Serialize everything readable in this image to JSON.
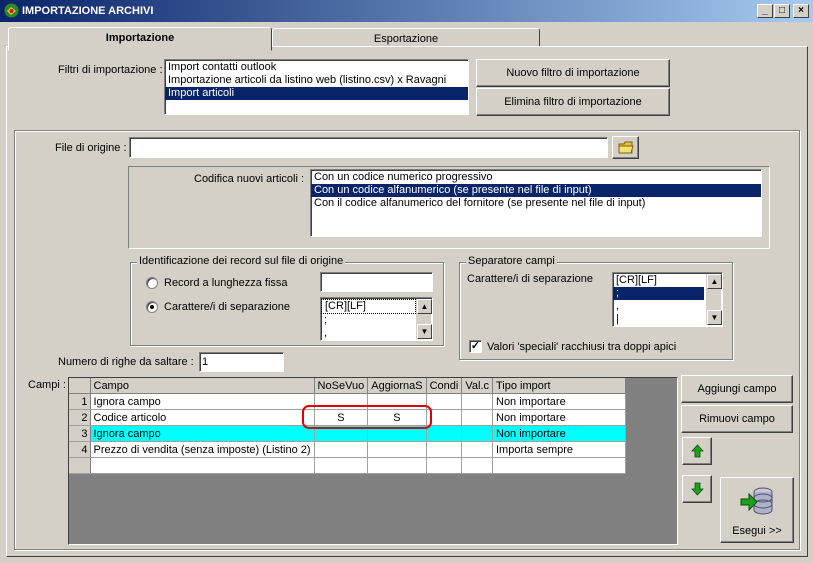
{
  "window": {
    "title": "IMPORTAZIONE ARCHIVI",
    "min_label": "_",
    "max_label": "□",
    "close_label": "×"
  },
  "tabs": [
    {
      "label": "Importazione"
    },
    {
      "label": "Esportazione"
    }
  ],
  "filters": {
    "label": "Filtri di importazione :",
    "items": [
      "Import contatti outlook",
      "Importazione articoli da listino web (listino.csv) x Ravagni",
      "Import articoli"
    ],
    "selected_index": 2,
    "new_button": "Nuovo filtro di importazione",
    "delete_button": "Elimina filtro di importazione"
  },
  "source_file": {
    "label": "File di origine :",
    "value": ""
  },
  "encoding": {
    "label": "Codifica nuovi articoli :",
    "options": [
      "Con un codice numerico progressivo",
      "Con un codice alfanumerico (se presente nel file di input)",
      "Con il codice alfanumerico del fornitore (se presente nel file di input)"
    ],
    "selected_index": 1
  },
  "record_identification": {
    "legend": "Identificazione dei record sul file di origine",
    "fixed_length_label": "Record a lunghezza fissa",
    "fixed_length_value": "",
    "separator_label": "Carattere/i di separazione",
    "separator_items": [
      "[CR][LF]",
      ";",
      ","
    ]
  },
  "field_separator": {
    "legend": "Separatore campi",
    "label": "Carattere/i di separazione",
    "items": [
      "[CR][LF]",
      ";",
      ",",
      "|"
    ],
    "selected_index": 1,
    "special_values_label": "Valori 'speciali' racchiusi tra doppi apici",
    "special_values_checked": "✓"
  },
  "skip_rows": {
    "label": "Numero di righe da saltare  :",
    "value": "1"
  },
  "fields": {
    "label": "Campi :",
    "columns": [
      "Campo",
      "NoSeVuo",
      "AggiornaS",
      "Condi",
      "Val.c",
      "Tipo import"
    ],
    "rows": [
      {
        "num": "1",
        "campo": "Ignora campo",
        "nosevuo": "",
        "aggiorna": "",
        "condi": "",
        "valc": "",
        "tipo": "Non importare"
      },
      {
        "num": "2",
        "campo": "Codice articolo",
        "nosevuo": "S",
        "aggiorna": "S",
        "condi": "",
        "valc": "",
        "tipo": "Non importare"
      },
      {
        "num": "3",
        "campo": "Ignora campo",
        "nosevuo": "",
        "aggiorna": "",
        "condi": "",
        "valc": "",
        "tipo": "Non importare"
      },
      {
        "num": "4",
        "campo": "Prezzo di vendita (senza imposte) (Listino 2)",
        "nosevuo": "",
        "aggiorna": "",
        "condi": "",
        "valc": "",
        "tipo": "Importa sempre"
      }
    ],
    "selected_row": 2,
    "add_button": "Aggiungi campo",
    "remove_button": "Rimuovi campo",
    "execute_button": "Esegui >>"
  },
  "colors": {
    "selection": "#0a246a",
    "highlight_row": "#00ffff",
    "annotation": "#e00000",
    "arrow_green": "#1ea01e"
  }
}
